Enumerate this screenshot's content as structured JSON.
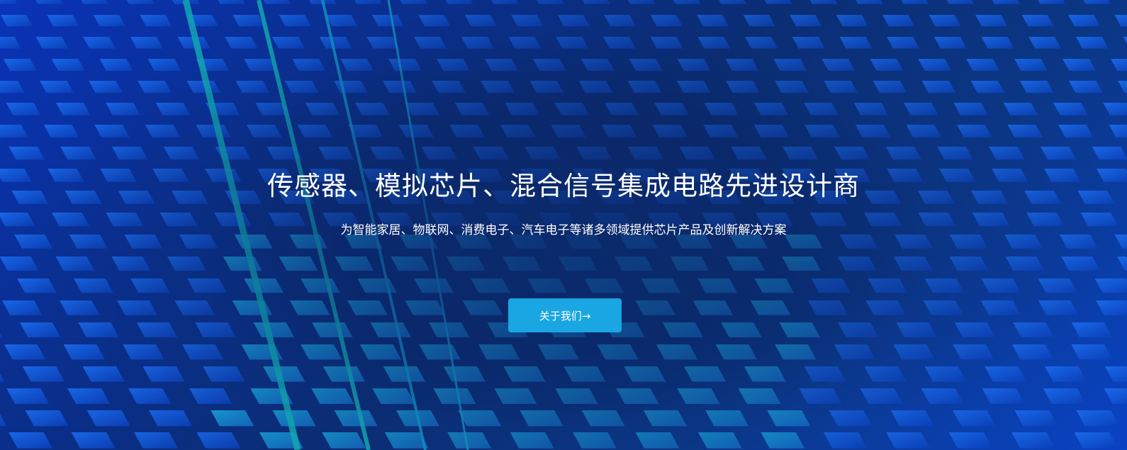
{
  "hero": {
    "title": "传感器、模拟芯片、混合信号集成电路先进设计商",
    "subtitle": "为智能家居、物联网、消费电子、汽车电子等诸多领域提供芯片产品及创新解决方案",
    "button_label": "关于我们→"
  },
  "colors": {
    "background_deep": "#061c52",
    "background_blue": "#0a33b8",
    "tile_blue": "#1b6df0",
    "tile_cyan": "#1aa6d8",
    "stripe_teal": "#12a7b0",
    "button": "#19a6e2",
    "text": "#ffffff"
  }
}
